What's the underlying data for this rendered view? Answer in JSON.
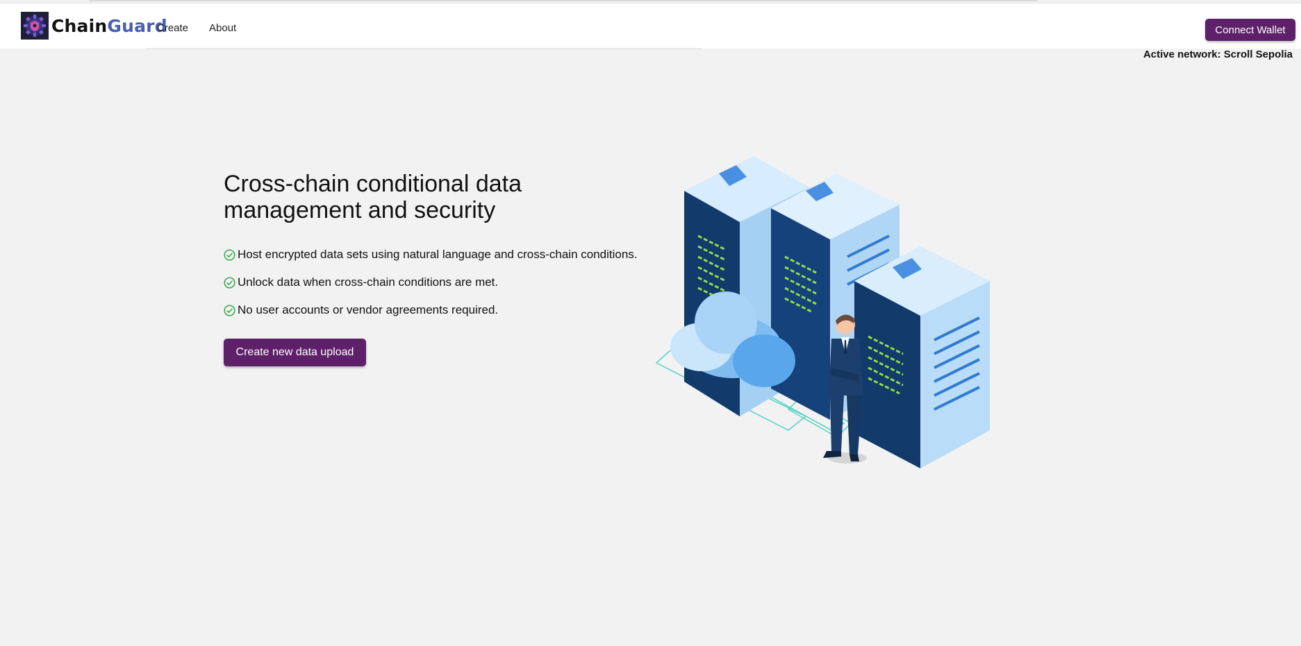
{
  "app": {
    "brand_part1": "Chain",
    "brand_part2": "Guard"
  },
  "nav": {
    "create_label": "Create",
    "about_label": "About",
    "connect_wallet_label": "Connect Wallet"
  },
  "status": {
    "active_network": "Active network: Scroll Sepolia"
  },
  "hero": {
    "title": "Cross-chain conditional data management and security",
    "features": [
      "Host encrypted data sets using natural language and cross-chain conditions.",
      "Unlock data when cross-chain conditions are met.",
      "No user accounts or vendor agreements required."
    ],
    "cta_label": "Create new data upload"
  },
  "icons": {
    "logo": "gear-shield-logo-icon",
    "feature_bullet": "check-circle-icon",
    "illustration": "server-cloud-illustration"
  },
  "colors": {
    "accent": "#5e2169",
    "brand_blue": "#4a5fb0",
    "check_green": "#2eaa4a",
    "background": "#f2f2f2"
  }
}
